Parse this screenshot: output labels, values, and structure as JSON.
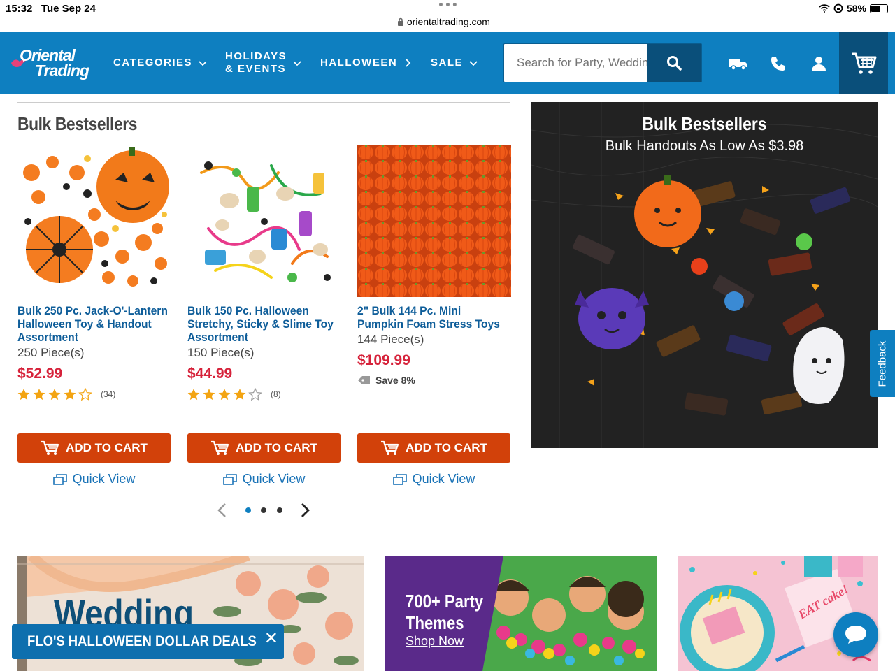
{
  "status_bar": {
    "time": "15:32",
    "date": "Tue Sep 24",
    "url": "orientaltrading.com",
    "battery": "58%"
  },
  "header": {
    "logo_line1": "Oriental",
    "logo_line2": "Trading",
    "nav": [
      {
        "label": "CATEGORIES"
      },
      {
        "label_line1": "HOLIDAYS",
        "label_line2": "& EVENTS"
      },
      {
        "label": "HALLOWEEN"
      },
      {
        "label": "SALE"
      }
    ],
    "search_placeholder": "Search for Party, Wedding & more"
  },
  "section": {
    "title": "Bulk Bestsellers"
  },
  "products": [
    {
      "name": "Bulk 250 Pc. Jack-O'-Lantern Halloween Toy & Handout Assortment",
      "qty": "250 Piece(s)",
      "price": "$52.99",
      "rating": 4.5,
      "reviews": "(34)"
    },
    {
      "name": "Bulk 150 Pc. Halloween Stretchy, Sticky & Slime Toy Assortment",
      "qty": "150 Piece(s)",
      "price": "$44.99",
      "rating": 4,
      "reviews": "(8)"
    },
    {
      "name": "2\" Bulk 144 Pc. Mini Pumpkin Foam Stress Toys",
      "qty": "144 Piece(s)",
      "price": "$109.99",
      "save": "Save 8%"
    }
  ],
  "buttons": {
    "add_to_cart": "ADD TO CART",
    "quick_view": "Quick View"
  },
  "carousel": {
    "pages": 3,
    "active": 1
  },
  "banner": {
    "title": "Bulk Bestsellers",
    "subtitle": "Bulk Handouts As Low As $3.98"
  },
  "feedback": "Feedback",
  "tiles": {
    "wedding": "Wedding",
    "party_line1": "700+ Party",
    "party_line2": "Themes",
    "party_link": "Shop Now",
    "eat_cake": "EAT cake!"
  },
  "promo": "FLO'S HALLOWEEN DOLLAR DEALS",
  "colors": {
    "nav_blue": "#0e7fc0",
    "dark_blue": "#0a4f7a",
    "cart_orange": "#d2410a",
    "price_red": "#d6223a",
    "link_blue": "#0e5d99"
  }
}
